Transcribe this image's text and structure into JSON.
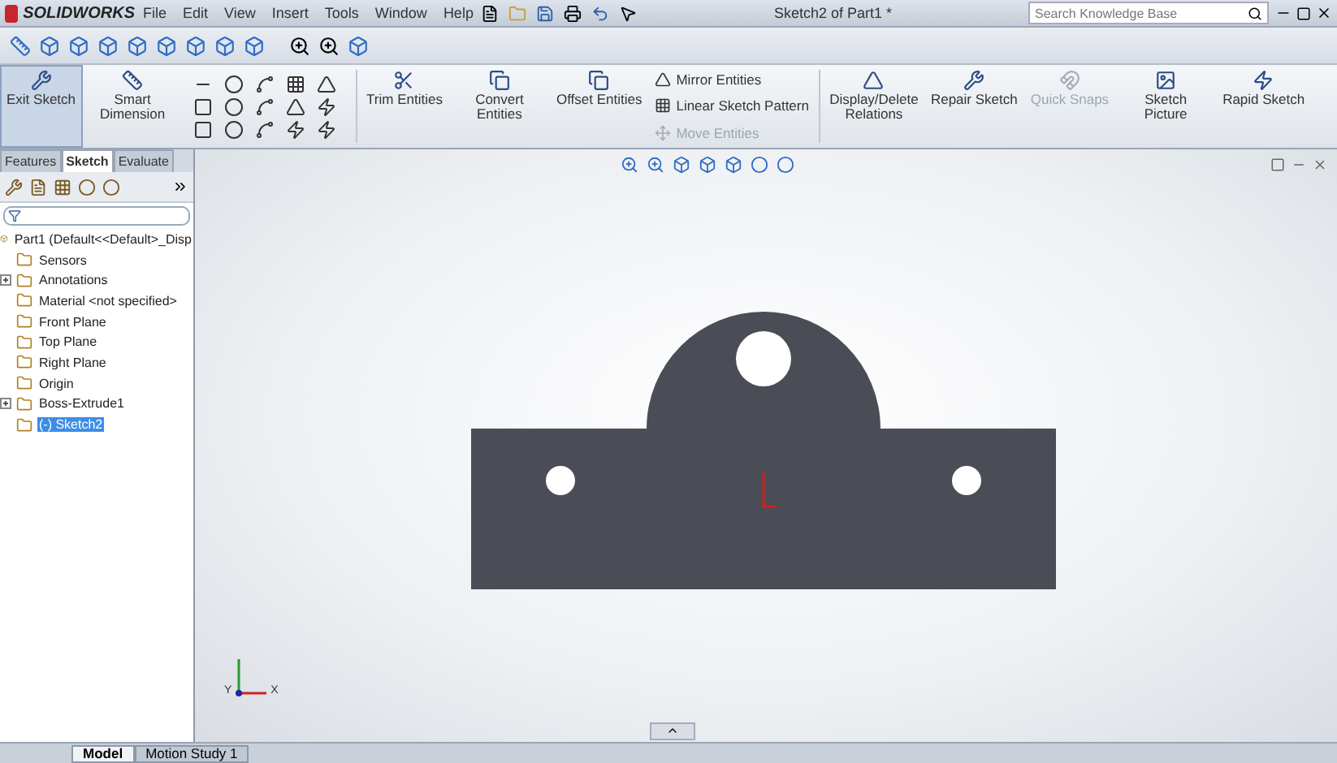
{
  "app": {
    "logo": "SOLIDWORKS"
  },
  "menu": [
    "File",
    "Edit",
    "View",
    "Insert",
    "Tools",
    "Window",
    "Help"
  ],
  "window": {
    "title": "Sketch2 of Part1 *"
  },
  "search": {
    "placeholder": "Search Knowledge Base"
  },
  "command_manager": {
    "tools": [
      {
        "label": "Exit Sketch",
        "selected": true,
        "disabled": false
      },
      {
        "label": "Smart Dimension",
        "selected": false,
        "disabled": false
      },
      {
        "label": "Trim Entities",
        "selected": false,
        "disabled": false
      },
      {
        "label": "Convert Entities",
        "selected": false,
        "disabled": false
      },
      {
        "label": "Offset Entities",
        "selected": false,
        "disabled": false
      }
    ],
    "small_tools": [
      {
        "label": "Mirror Entities",
        "disabled": false
      },
      {
        "label": "Linear Sketch Pattern",
        "disabled": false
      },
      {
        "label": "Move Entities",
        "disabled": true
      }
    ],
    "tools_right": [
      {
        "label": "Display/Delete Relations",
        "selected": false,
        "disabled": false
      },
      {
        "label": "Repair Sketch",
        "selected": false,
        "disabled": false
      },
      {
        "label": "Quick Snaps",
        "selected": false,
        "disabled": true
      },
      {
        "label": "Sketch Picture",
        "selected": false,
        "disabled": false
      },
      {
        "label": "Rapid Sketch",
        "selected": false,
        "disabled": false
      }
    ]
  },
  "panel": {
    "tabs": [
      {
        "label": "Features",
        "selected": false
      },
      {
        "label": "Sketch",
        "selected": true
      },
      {
        "label": "Evaluate",
        "selected": false
      }
    ],
    "tree": {
      "label": "Part1  (Default<<Default>_Disp",
      "children": [
        {
          "label": "Sensors",
          "expandable": false,
          "selected": false
        },
        {
          "label": "Annotations",
          "expandable": true,
          "selected": false
        },
        {
          "label": "Material <not specified>",
          "expandable": false,
          "selected": false
        },
        {
          "label": "Front Plane",
          "expandable": false,
          "selected": false
        },
        {
          "label": "Top Plane",
          "expandable": false,
          "selected": false
        },
        {
          "label": "Right Plane",
          "expandable": false,
          "selected": false
        },
        {
          "label": "Origin",
          "expandable": false,
          "selected": false
        },
        {
          "label": "Boss-Extrude1",
          "expandable": true,
          "selected": false
        },
        {
          "label": "(-) Sketch2",
          "expandable": false,
          "selected": true
        }
      ]
    }
  },
  "triad": {
    "x": "X",
    "y": "Y"
  },
  "bottom_tabs": [
    {
      "label": "Model",
      "selected": true
    },
    {
      "label": "Motion Study 1",
      "selected": false
    }
  ]
}
